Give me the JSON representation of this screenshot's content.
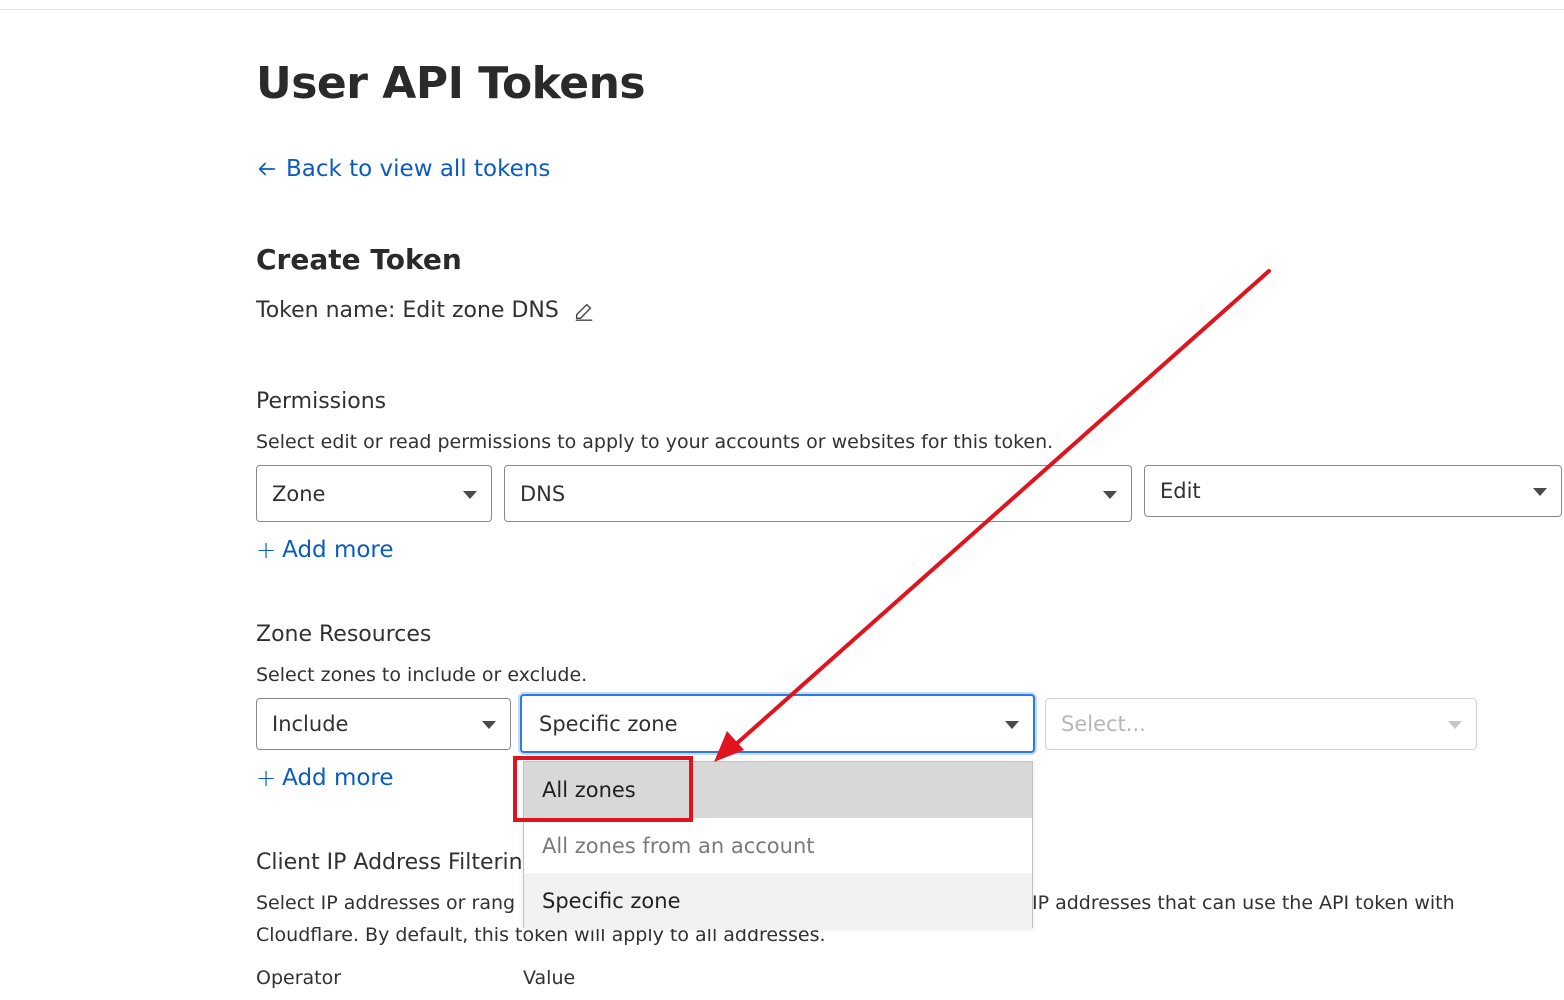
{
  "page": {
    "title": "User API Tokens",
    "back_link": "Back to view all tokens"
  },
  "create_token": {
    "heading": "Create Token",
    "token_name": "Token name: Edit zone DNS"
  },
  "permissions": {
    "heading": "Permissions",
    "description": "Select edit or read permissions to apply to your accounts or websites for this token.",
    "selects": [
      "Zone",
      "DNS",
      "Edit"
    ],
    "add_more": "Add more"
  },
  "zone_resources": {
    "heading": "Zone Resources",
    "description": "Select zones to include or exclude.",
    "include_select": "Include",
    "zone_select": "Specific zone",
    "value_placeholder": "Select...",
    "add_more": "Add more",
    "dropdown_options": [
      "All zones",
      "All zones from an account",
      "Specific zone"
    ]
  },
  "client_ip": {
    "heading": "Client IP Address Filterin",
    "description_line1_left": "Select IP addresses or rang",
    "description_line1_right": "IP addresses that can use the API token with",
    "description_line2": "Cloudflare. By default, this token will apply to all addresses.",
    "operator_label": "Operator",
    "value_label": "Value"
  },
  "annotation": {
    "highlight_color": "#e0141e",
    "arrow_color": "#e0141e"
  },
  "icons": {
    "back": "arrow-left-icon",
    "edit": "pencil-icon",
    "add": "plus-icon",
    "caret": "chevron-down-icon"
  }
}
